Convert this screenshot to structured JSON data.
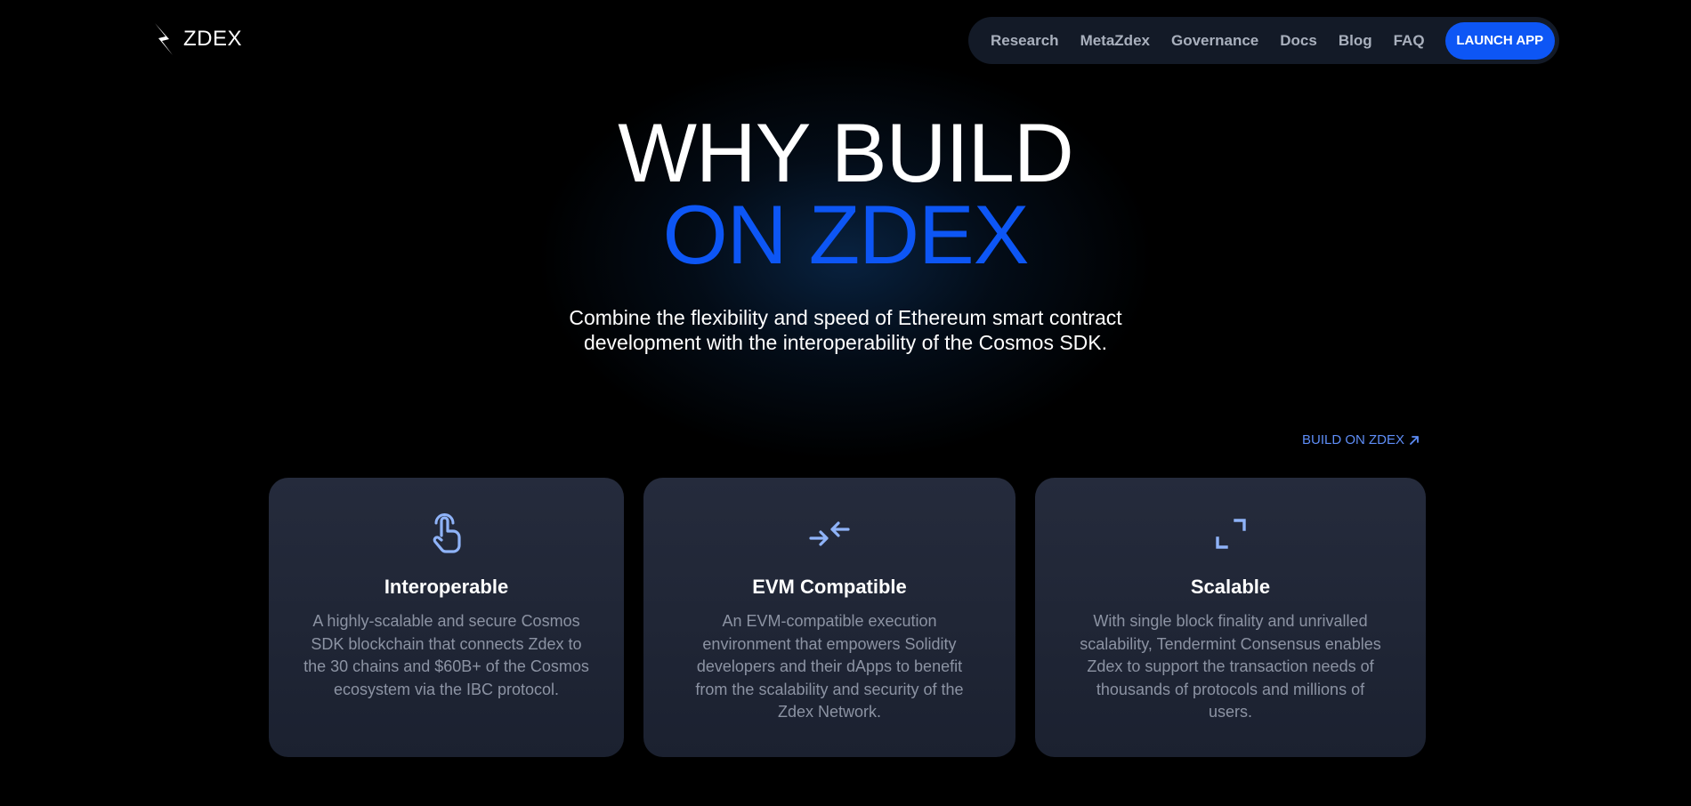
{
  "brand": {
    "name": "ZDEX",
    "logo_icon": "lightning-bolt-icon"
  },
  "nav": {
    "links": [
      "Research",
      "MetaZdex",
      "Governance",
      "Docs",
      "Blog",
      "FAQ"
    ],
    "cta_label": "LAUNCH APP"
  },
  "hero": {
    "title_line1": "WHY BUILD",
    "title_line2": "ON ZDEX",
    "subtitle_line1": "Combine the flexibility and speed of Ethereum smart contract",
    "subtitle_line2": "development with the interoperability of the Cosmos SDK.",
    "link_label": "BUILD ON ZDEX",
    "link_icon": "arrow-up-right-icon"
  },
  "cards": [
    {
      "icon": "pointer-finger-icon",
      "title": "Interoperable",
      "desc": "A highly-scalable and secure Cosmos SDK blockchain that connects Zdex to the 30 chains and $60B+ of the Cosmos ecosystem via the IBC protocol."
    },
    {
      "icon": "arrows-converge-icon",
      "title": "EVM Compatible",
      "desc": "An EVM-compatible execution environment that empowers Solidity developers and their dApps to benefit from the scalability and security of the Zdex Network."
    },
    {
      "icon": "expand-corners-icon",
      "title": "Scalable",
      "desc": "With single block finality and unrivalled scalability, Tendermint Consensus enables Zdex to support the transaction needs of thousands of protocols and millions of users."
    }
  ],
  "colors": {
    "background": "#000000",
    "accent": "#0d56f5",
    "nav_bg": "#131a27",
    "card_bg": "#252b3c",
    "link": "#5e8df6",
    "icon": "#8fb3f8",
    "muted_text": "#8c93a3"
  }
}
